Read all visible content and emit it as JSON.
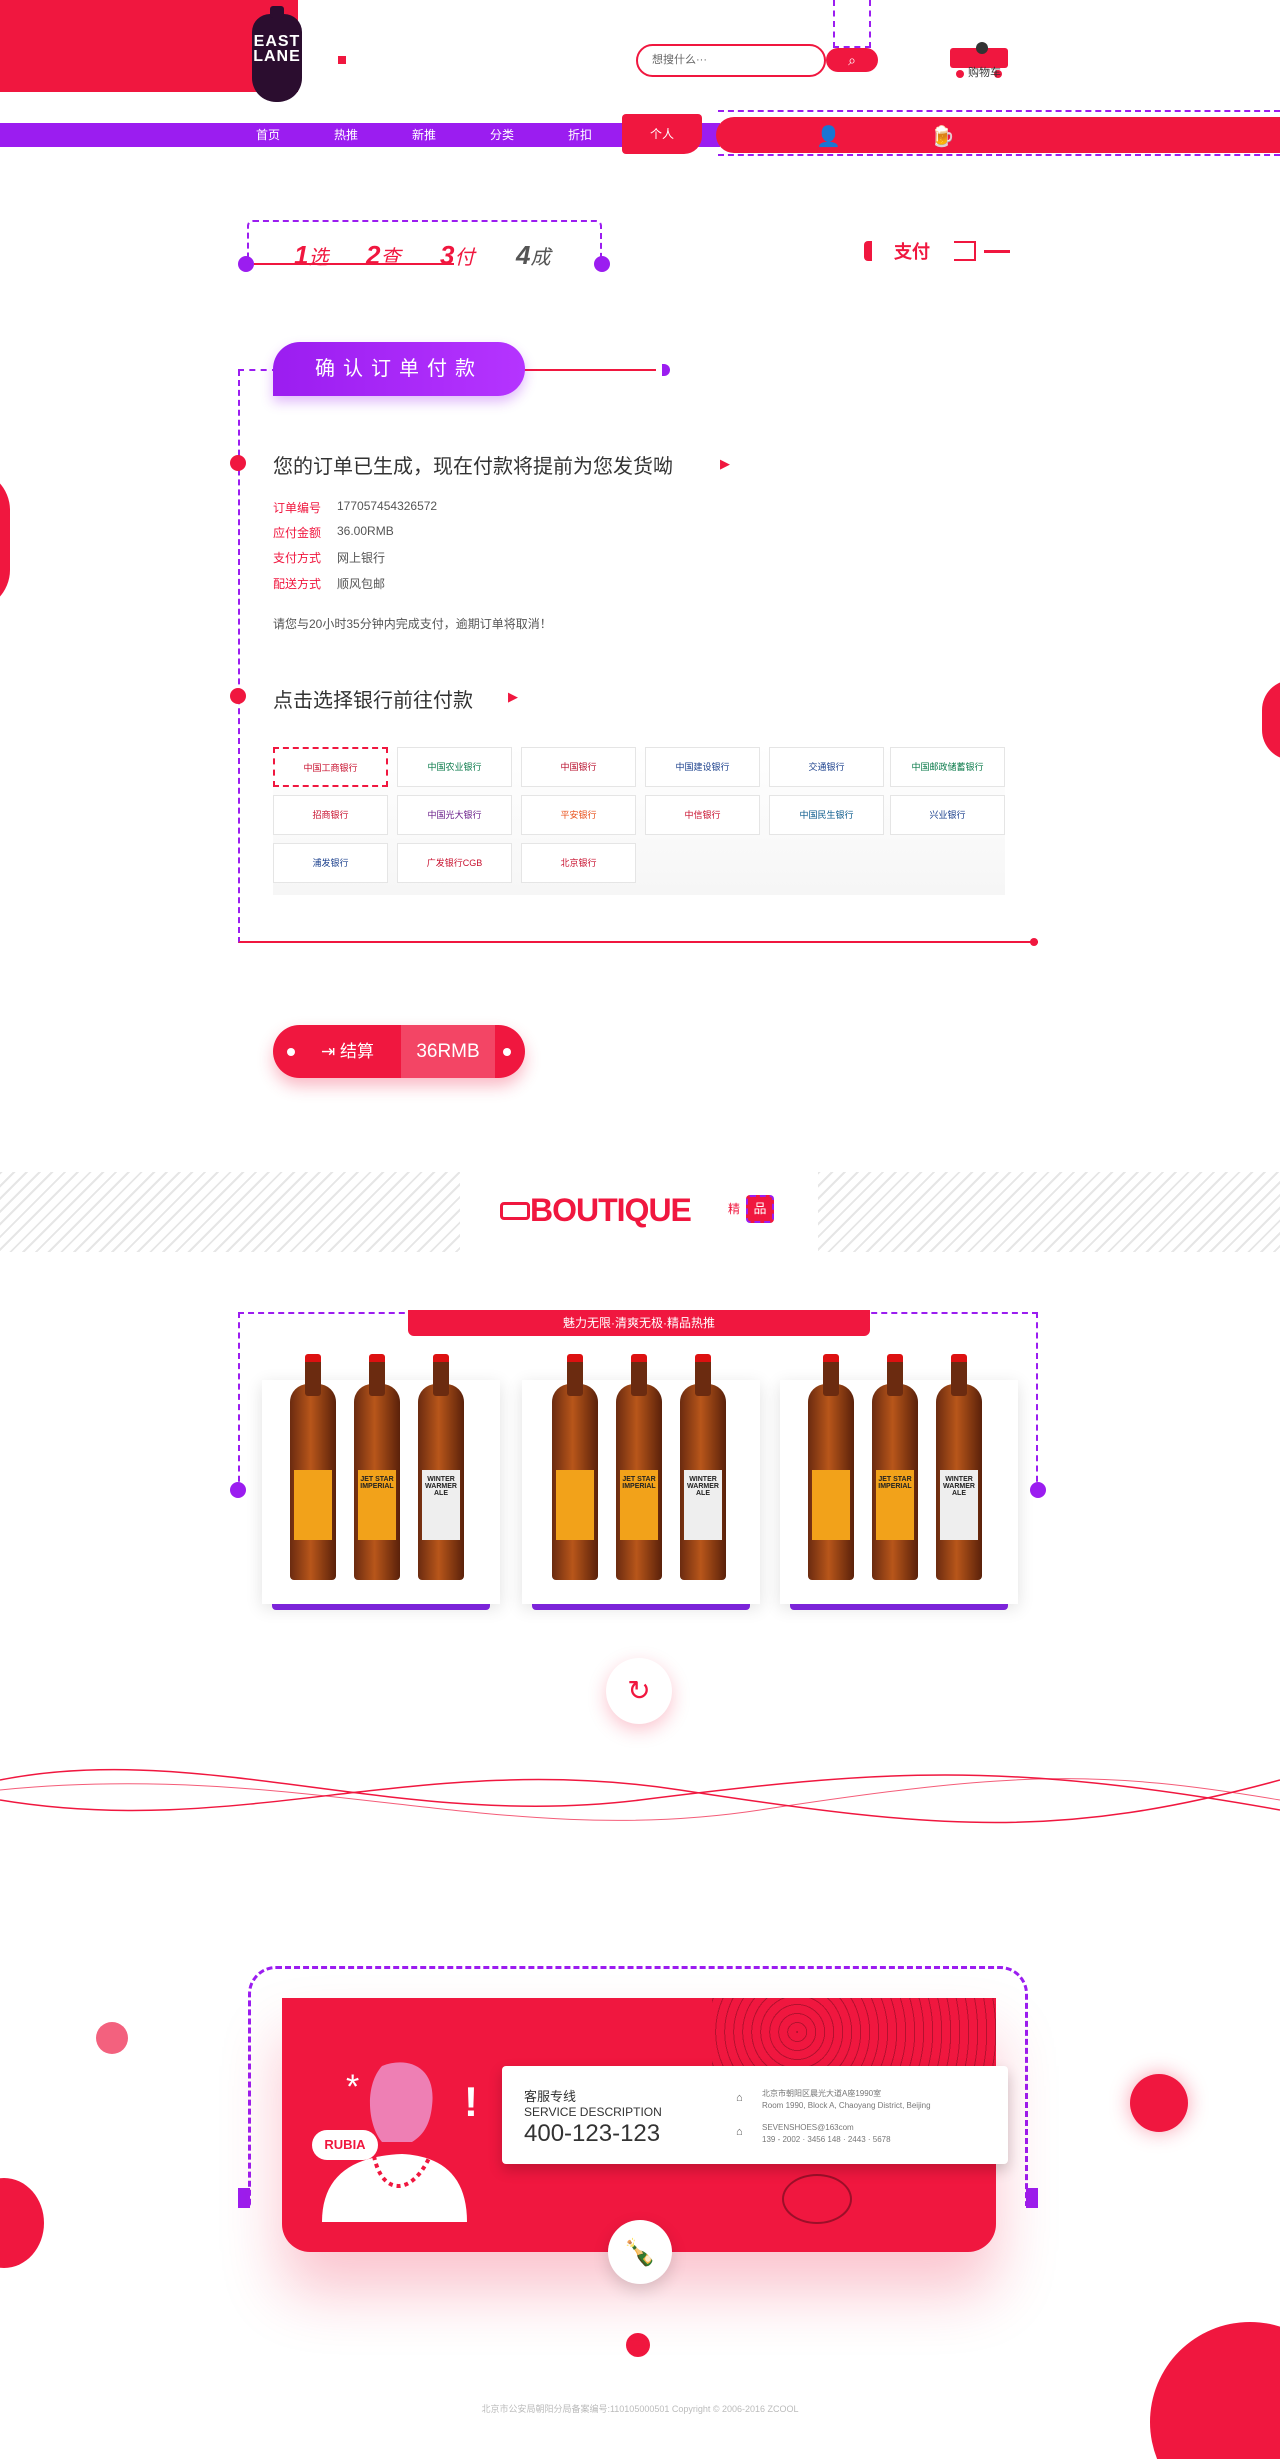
{
  "header": {
    "logo_text": [
      "EAST",
      "LANE"
    ],
    "search_placeholder": "想搜什么···",
    "cart_label": "购物车"
  },
  "nav": {
    "items": [
      "首页",
      "热推",
      "新推",
      "分类",
      "折扣"
    ],
    "active": "个人"
  },
  "steps": {
    "items": [
      {
        "num": "1",
        "label": "选"
      },
      {
        "num": "2",
        "label": "查"
      },
      {
        "num": "3",
        "label": "付"
      },
      {
        "num": "4",
        "label": "成"
      }
    ],
    "current_label": "支付"
  },
  "order": {
    "title": "确认订单付款",
    "message": "您的订单已生成，现在付款将提前为您发货呦",
    "fields": [
      {
        "k": "订单编号",
        "v": "1770574543265​72"
      },
      {
        "k": "应付金额",
        "v": "36.00RMB"
      },
      {
        "k": "支付方式",
        "v": "网上银行"
      },
      {
        "k": "配送方式",
        "v": "顺风包邮"
      }
    ],
    "notice": "请您与20小时35分钟内完成支付，逾期订单将取消！",
    "bank_title": "点击选择银行前往付款",
    "banks": [
      "中国工商银行",
      "中国农业银行",
      "中国银行",
      "中国建设银行",
      "交通银行",
      "中国邮政储蓄银行",
      "招商银行",
      "中国光大银行",
      "平安银行",
      "中信银行",
      "中国民生银行",
      "兴业银行",
      "浦发银行",
      "广发银行CGB",
      "北京银行"
    ]
  },
  "checkout": {
    "label": "结算",
    "amount": "36RMB"
  },
  "boutique": {
    "title": "BOUTIQUE",
    "cn_small": "精",
    "cn_badge": "品",
    "ribbon": "魅力无限·清爽无极·精品热推",
    "bottle_labels": [
      "",
      "JET STAR IMPERIAL",
      "WINTER WARMER ALE"
    ]
  },
  "footer": {
    "service_title": "客服专线",
    "service_en": "SERVICE DESCRIPTION",
    "phone": "400-123-123",
    "address_cn": "北京市朝阳区晨光大道A座1990室",
    "address_en": "Room 1990, Block A, Chaoyang District, Beijing",
    "email": "SEVENSHOES@163com",
    "phone2": "139 - 2002 · 3456   148 · 2443 · 5678",
    "badge": "RUBIA",
    "copyright": "北京市公安局朝阳分局备案编号:110105000501   Copyright © 2006-2016 ZCOOL"
  },
  "colors": {
    "accent": "#f0173f",
    "purple": "#9b1df0"
  }
}
